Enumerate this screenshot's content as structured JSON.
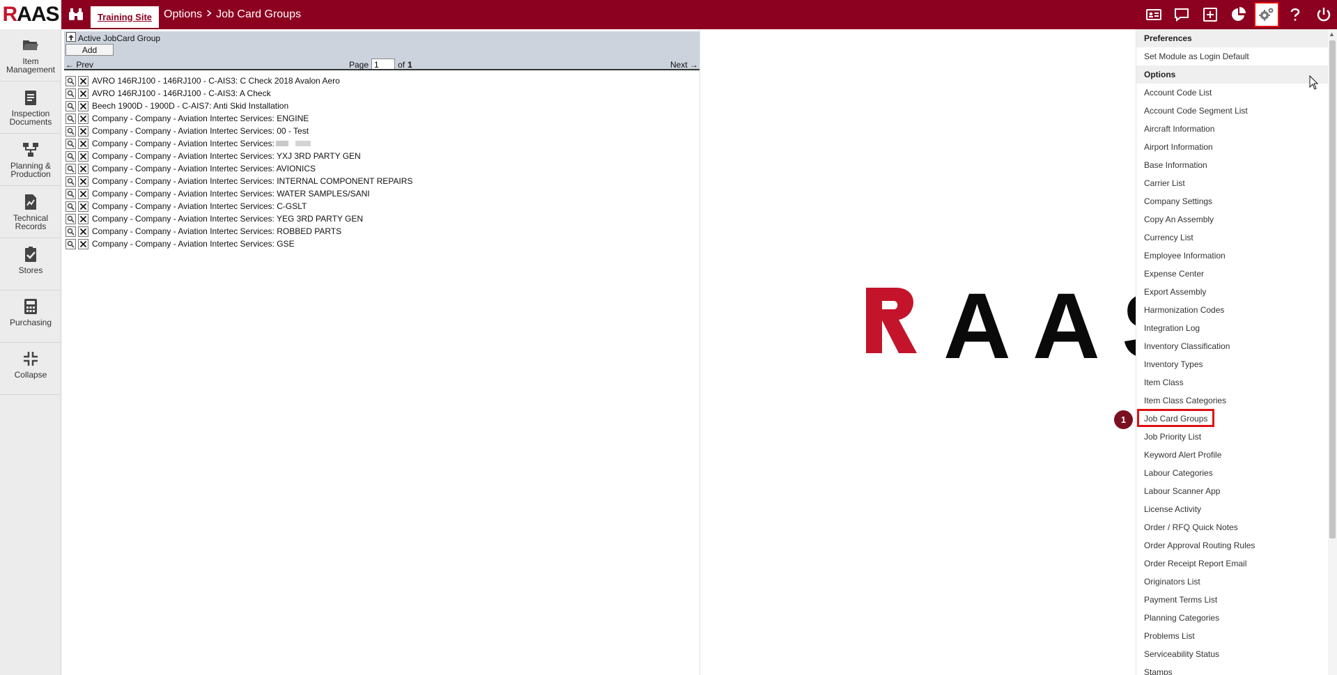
{
  "app": {
    "logo": "RAAS",
    "site_tab": "Training Site"
  },
  "breadcrumb": {
    "section": "Options",
    "page": "Job Card Groups"
  },
  "topbar_icons": [
    "contact-card-icon",
    "chat-icon",
    "add-box-icon",
    "pie-chart-icon",
    "settings-icon",
    "help-icon",
    "power-icon"
  ],
  "sidebar": {
    "items": [
      {
        "label": "Item Management",
        "icon": "folder-icon"
      },
      {
        "label": "Inspection Documents",
        "icon": "clipboard-icon"
      },
      {
        "label": "Planning & Production",
        "icon": "workflow-icon"
      },
      {
        "label": "Technical Records",
        "icon": "chart-file-icon"
      },
      {
        "label": "Stores",
        "icon": "checklist-icon"
      },
      {
        "label": "Purchasing",
        "icon": "calculator-icon"
      },
      {
        "label": "Collapse",
        "icon": "collapse-icon"
      }
    ]
  },
  "panel": {
    "title": "Active JobCard Group",
    "add_label": "Add",
    "prev_label": "← Prev",
    "next_label": "Next →",
    "page_label": "Page",
    "page_value": "1",
    "of_label": "of",
    "page_total": "1"
  },
  "rows": [
    "AVRO 146RJ100 - 146RJ100 - C-AIS3: C Check 2018 Avalon Aero",
    "AVRO 146RJ100 - 146RJ100 - C-AIS3: A Check",
    "Beech 1900D - 1900D - C-AIS7: Anti Skid Installation",
    "Company - Company - Aviation Intertec Services: ENGINE",
    "Company - Company - Aviation Intertec Services: 00 - Test",
    "Company - Company - Aviation Intertec Services:",
    "Company - Company - Aviation Intertec Services: YXJ 3RD PARTY GEN",
    "Company - Company - Aviation Intertec Services: AVIONICS",
    "Company - Company - Aviation Intertec Services: INTERNAL COMPONENT REPAIRS",
    "Company - Company - Aviation Intertec Services: WATER SAMPLES/SANI",
    "Company - Company - Aviation Intertec Services: C-GSLT",
    "Company - Company - Aviation Intertec Services: YEG 3RD PARTY GEN",
    "Company - Company - Aviation Intertec Services: ROBBED PARTS",
    "Company - Company - Aviation Intertec Services: GSE"
  ],
  "watermark": "RAAS",
  "dropdown": {
    "preferences_header": "Preferences",
    "preferences_items": [
      "Set Module as Login Default"
    ],
    "options_header": "Options",
    "options_items": [
      "Account Code List",
      "Account Code Segment List",
      "Aircraft Information",
      "Airport Information",
      "Base Information",
      "Carrier List",
      "Company Settings",
      "Copy An Assembly",
      "Currency List",
      "Employee Information",
      "Expense Center",
      "Export Assembly",
      "Harmonization Codes",
      "Integration Log",
      "Inventory Classification",
      "Inventory Types",
      "Item Class",
      "Item Class Categories",
      "Job Card Groups",
      "Job Priority List",
      "Keyword Alert Profile",
      "Labour Categories",
      "Labour Scanner App",
      "License Activity",
      "Order / RFQ Quick Notes",
      "Order Approval Routing Rules",
      "Order Receipt Report Email",
      "Originators List",
      "Payment Terms List",
      "Planning Categories",
      "Problems List",
      "Serviceability Status",
      "Stamps"
    ]
  },
  "step_badge": "1",
  "colors": {
    "brand": "#8c0020",
    "logo_red": "#c4142c",
    "highlight": "#e01010",
    "panel_header": "#ccd3dc"
  }
}
